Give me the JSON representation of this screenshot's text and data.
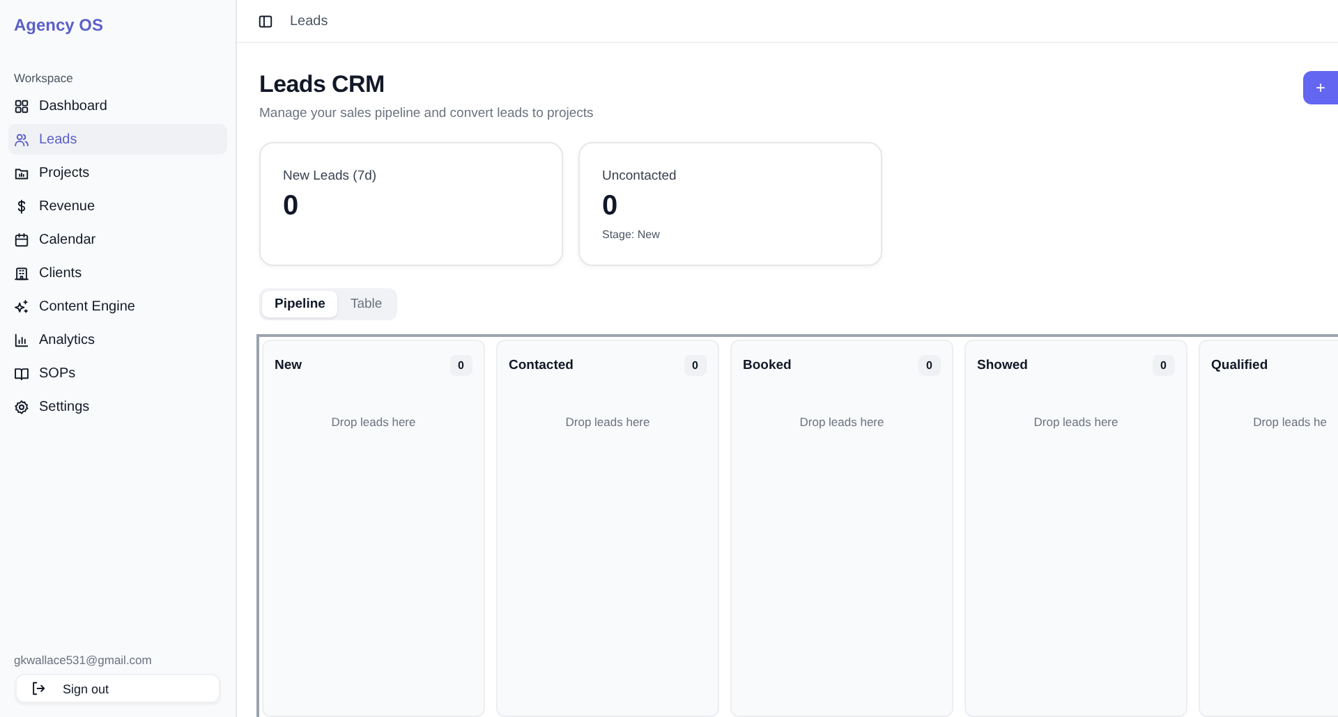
{
  "sidebar": {
    "brand": "Agency OS",
    "section": "Workspace",
    "items": [
      {
        "label": "Dashboard",
        "selected": false
      },
      {
        "label": "Leads",
        "selected": true
      },
      {
        "label": "Projects",
        "selected": false
      },
      {
        "label": "Revenue",
        "selected": false
      },
      {
        "label": "Calendar",
        "selected": false
      },
      {
        "label": "Clients",
        "selected": false
      },
      {
        "label": "Content Engine",
        "selected": false
      },
      {
        "label": "Analytics",
        "selected": false
      },
      {
        "label": "SOPs",
        "selected": false
      },
      {
        "label": "Settings",
        "selected": false
      }
    ],
    "email": "gkwallace531@gmail.com",
    "sign_out": "Sign out"
  },
  "breadcrumb": "Leads",
  "page": {
    "title": "Leads CRM",
    "subtitle": "Manage your sales pipeline and convert leads to projects",
    "add_button": "+"
  },
  "stats": [
    {
      "label": "New Leads (7d)",
      "value": "0"
    },
    {
      "label": "Uncontacted",
      "value": "0",
      "note": "Stage: New"
    }
  ],
  "view_tabs": [
    {
      "label": "Pipeline",
      "selected": true
    },
    {
      "label": "Table",
      "selected": false
    }
  ],
  "columns": [
    {
      "name": "New",
      "count": "0",
      "empty": "Drop leads here"
    },
    {
      "name": "Contacted",
      "count": "0",
      "empty": "Drop leads here"
    },
    {
      "name": "Booked",
      "count": "0",
      "empty": "Drop leads here"
    },
    {
      "name": "Showed",
      "count": "0",
      "empty": "Drop leads here"
    },
    {
      "name": "Qualified",
      "empty": "Drop leads he"
    }
  ]
}
